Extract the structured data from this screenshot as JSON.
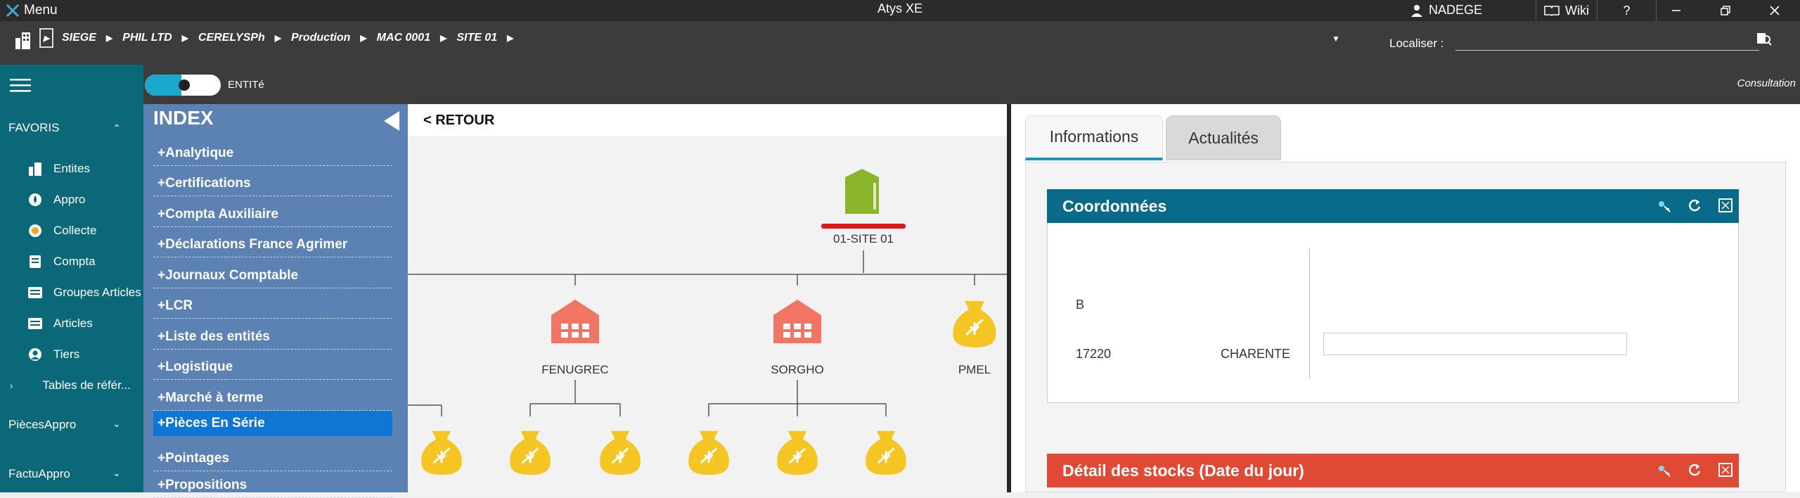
{
  "window": {
    "menu_label": "Menu",
    "app_title": "Atys XE",
    "user_name": "NADEGE",
    "wiki_label": "Wiki",
    "help_label": "?"
  },
  "breadcrumb": {
    "items": [
      "SIEGE",
      "PHIL LTD",
      "CERELYSPh",
      "Production",
      "MAC 0001",
      "SITE 01"
    ],
    "locate_label": "Localiser :"
  },
  "sidebar": {
    "favoris_label": "FAVORIS",
    "items": [
      {
        "label": "Entites",
        "icon": "building-icon"
      },
      {
        "label": "Appro",
        "icon": "drop-icon"
      },
      {
        "label": "Collecte",
        "icon": "coin-icon"
      },
      {
        "label": "Compta",
        "icon": "doc-icon"
      },
      {
        "label": "Groupes Articles",
        "icon": "list-icon"
      },
      {
        "label": "Articles",
        "icon": "list-icon"
      },
      {
        "label": "Tiers",
        "icon": "person-icon"
      },
      {
        "label": "Tables de référ...",
        "icon": "chevron-right-icon"
      }
    ],
    "sections": [
      "PiècesAppro",
      "FactuAppro"
    ]
  },
  "toolbar": {
    "toggle_label": "ENTITé",
    "mode_label": "Consultation"
  },
  "index": {
    "title": "INDEX",
    "items": [
      "+Analytique",
      "+Certifications",
      "+Compta Auxiliaire",
      "+Déclarations France Agrimer",
      "+Journaux Comptable",
      "+LCR",
      "+Liste des entités",
      "+Logistique",
      "+Marché à terme",
      "+Pièces En Série",
      "+Pointages",
      "+Propositions"
    ],
    "selected_index": 9
  },
  "tree": {
    "back_label": "< RETOUR",
    "root_label": "01-SITE 01",
    "nodes": [
      "FENUGREC",
      "SORGHO",
      "PMEL"
    ]
  },
  "right": {
    "tabs": [
      "Informations",
      "Actualités"
    ],
    "coords": {
      "title": "Coordonnées",
      "line1": "B",
      "postal_code": "17220",
      "region": "CHARENTE"
    },
    "stocks": {
      "title": "Détail des stocks (Date du jour)"
    }
  },
  "colors": {
    "sidebar": "#0a6878",
    "index": "#5c82b3",
    "selected": "#1076d6",
    "coords_header": "#0a6a8a",
    "stocks_header": "#e04a35",
    "silo": "#8ab42a",
    "warehouse": "#f07565",
    "bag": "#f5c623"
  }
}
